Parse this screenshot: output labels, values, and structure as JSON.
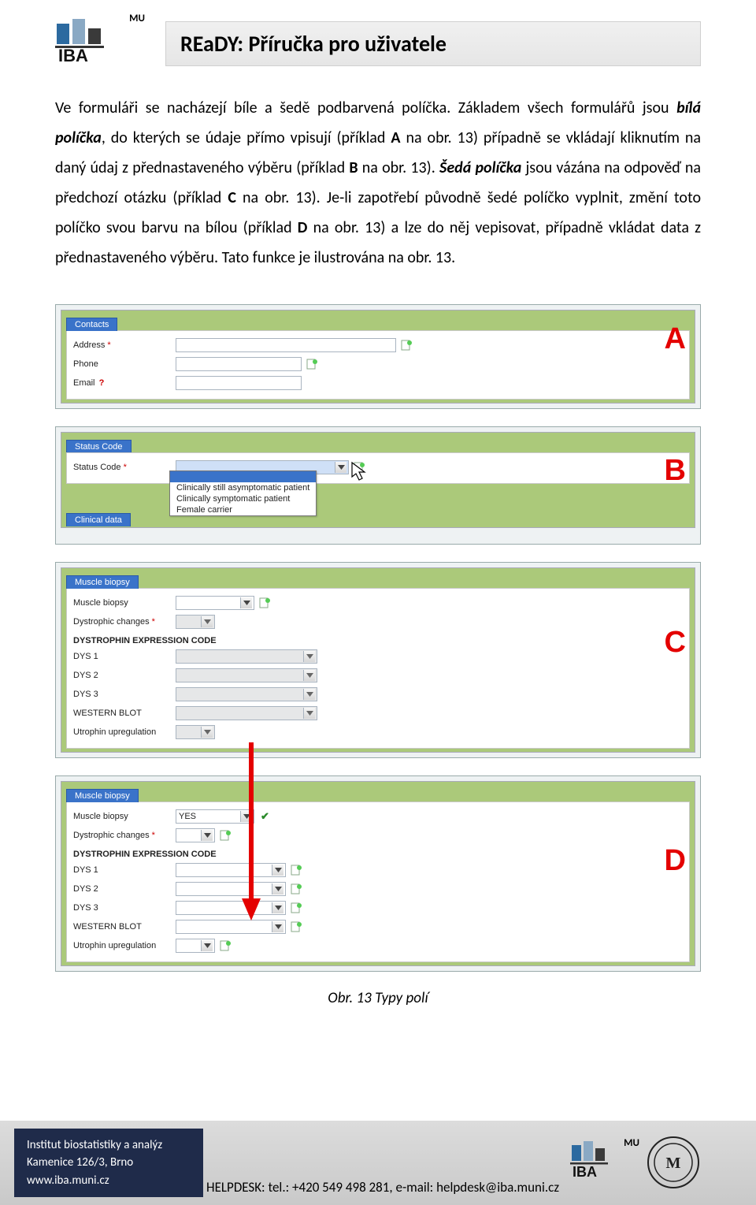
{
  "header": {
    "logo_text": "IBA",
    "logo_mu": "MU",
    "title": "REaDY:    Příručka pro uživatele"
  },
  "body": {
    "p1a": "Ve formuláři se nacházejí bíle a šedě podbarvená políčka. Základem všech formulářů jsou ",
    "p1_bi1": "bílá políčka",
    "p1b": ", do kterých se údaje přímo vpisují (příklad ",
    "p1_A": "A",
    "p1c": " na obr. 13) případně se vkládají kliknutím na daný údaj z přednastaveného výběru (příklad ",
    "p1_B": "B",
    "p1d": " na obr. 13). ",
    "p1_bi2": "Šedá políčka",
    "p1e": " jsou vázána na odpověď na předchozí otázku (příklad ",
    "p1_C": "C",
    "p1f": " na obr. 13). Je-li zapotřebí původně šedé políčko vyplnit, změní toto políčko svou barvu na bílou (příklad ",
    "p1_D": "D",
    "p1g": " na obr. 13) a lze do něj vepisovat, případně vkládat data z přednastaveného výběru. Tato funkce je ilustrována na obr. 13."
  },
  "panelA": {
    "tab": "Contacts",
    "address_lbl": "Address",
    "phone_lbl": "Phone",
    "email_lbl": "Email",
    "letter": "A"
  },
  "panelB": {
    "tab": "Status Code",
    "status_lbl": "Status Code",
    "opt1": "Clinically still asymptomatic patient",
    "opt2": "Clinically symptomatic patient",
    "opt3": "Female carrier",
    "second_tab": "Clinical data",
    "letter": "B"
  },
  "panelC": {
    "tab": "Muscle biopsy",
    "muscle_lbl": "Muscle biopsy",
    "dystr_lbl": "Dystrophic changes",
    "code_head": "DYSTROPHIN EXPRESSION CODE",
    "dys1": "DYS 1",
    "dys2": "DYS 2",
    "dys3": "DYS 3",
    "wb": "WESTERN BLOT",
    "utrophin": "Utrophin upregulation",
    "letter": "C"
  },
  "panelD": {
    "tab": "Muscle biopsy",
    "muscle_lbl": "Muscle biopsy",
    "muscle_val": "YES",
    "dystr_lbl": "Dystrophic changes",
    "code_head": "DYSTROPHIN EXPRESSION CODE",
    "dys1": "DYS 1",
    "dys2": "DYS 2",
    "dys3": "DYS 3",
    "wb": "WESTERN BLOT",
    "utrophin": "Utrophin upregulation",
    "letter": "D"
  },
  "caption": "Obr. 13 Typy polí",
  "footer": {
    "inst": "Institut biostatistiky a analýz",
    "addr": "Kamenice 126/3, Brno",
    "web": "www.iba.muni.cz",
    "helpdesk": "HELPDESK: tel.: +420 549 498 281, e-mail: helpdesk@iba.muni.cz",
    "logo_text": "IBA",
    "logo_mu": "MU"
  }
}
